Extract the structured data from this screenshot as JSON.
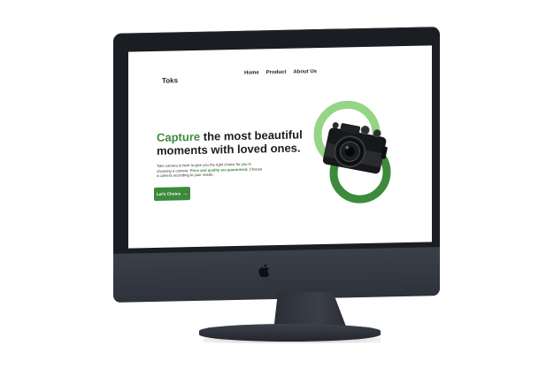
{
  "site": {
    "brand": "Toks",
    "nav": [
      "Home",
      "Product",
      "About Us"
    ]
  },
  "hero": {
    "title_accent": "Capture",
    "title_rest": " the most beautiful moments with loved ones.",
    "desc_part1": "Toks camera is here to give you the right choice for you in choosing a camera. ",
    "desc_highlight": "Price and quality are guaranteed.",
    "desc_part2": " Choose a camera according to your needs.",
    "cta_label": "Let's Choice",
    "cta_icon": "arrow-right-icon"
  },
  "colors": {
    "accent": "#3f8a3d",
    "button": "#3c8a3b",
    "ring_light": "#8fd37f",
    "ring_dark": "#3c8a3b",
    "bezel": "#1b1d22",
    "chin": "#343842"
  }
}
